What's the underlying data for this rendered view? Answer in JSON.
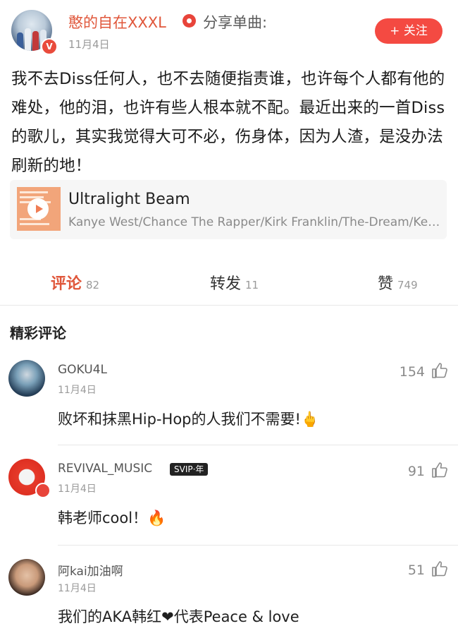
{
  "post": {
    "author": "憨的自在XXXL",
    "share_text": "分享单曲:",
    "date": "11月4日",
    "follow_label": "+ 关注",
    "body": "我不去Diss任何人，也不去随便指责谁，也许每个人都有他的难处，他的泪，也许有些人根本就不配。最近出来的一首Diss的歌儿，其实我觉得大可不必，伤身体，因为人渣，是没办法刷新的地！",
    "verified_badge": "V"
  },
  "music": {
    "title": "Ultralight Beam",
    "artist": "Kanye West/Chance The Rapper/Kirk Franklin/The-Dream/Kel..."
  },
  "tabs": [
    {
      "label": "评论",
      "count": "82"
    },
    {
      "label": "转发",
      "count": "11"
    },
    {
      "label": "赞",
      "count": "749"
    }
  ],
  "section_title": "精彩评论",
  "comments": [
    {
      "user": "GOKU4L",
      "date": "11月4日",
      "likes": "154",
      "text": "败坏和抹黑Hip-Hop的人我们不需要!🖕"
    },
    {
      "user": "REVIVAL_MUSIC",
      "badge": "SVIP·年",
      "date": "11月4日",
      "likes": "91",
      "text": "韩老师cool！🔥"
    },
    {
      "user": "阿kai加油啊",
      "date": "11月4日",
      "likes": "51",
      "text": "我们的AKA韩红❤代表Peace & love"
    }
  ],
  "colors": {
    "accent": "#e0573b",
    "follow_bg": "#f44a42"
  },
  "icons": {
    "like": "thumbs-up-icon",
    "music": "music-note-icon",
    "play": "play-icon"
  }
}
